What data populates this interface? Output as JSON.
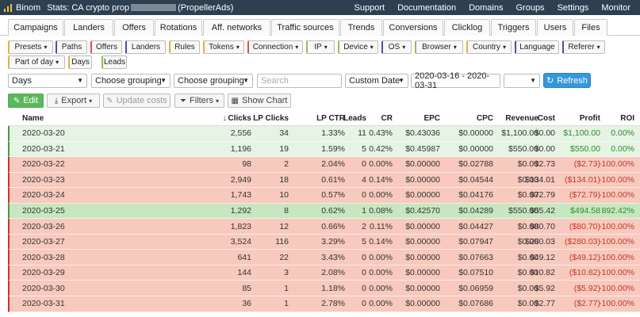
{
  "app": {
    "name": "Binom",
    "title_prefix": "Stats: CA crypto prop",
    "title_suffix": "(PropellerAds)"
  },
  "topnav": [
    "Support",
    "Documentation",
    "Domains",
    "Groups",
    "Settings",
    "Monitor"
  ],
  "tabs": [
    "Campaigns",
    "Landers",
    "Offers",
    "Rotations",
    "Aff. networks",
    "Traffic sources",
    "Trends",
    "Conversions",
    "Clicklog",
    "Triggers",
    "Users",
    "Files"
  ],
  "filters_row1": [
    {
      "label": "Presets",
      "caret": true,
      "color": "#e0b43a"
    },
    {
      "label": "Paths",
      "caret": false,
      "color": "#3f51b5"
    },
    {
      "label": "Offers",
      "caret": false,
      "color": "#d9534f"
    },
    {
      "label": "Landers",
      "caret": false,
      "color": "#3f51b5"
    },
    {
      "label": "Rules",
      "caret": false,
      "color": "#e0b43a"
    },
    {
      "label": "Tokens",
      "caret": true,
      "color": "#e0b43a"
    },
    {
      "label": "Connection",
      "caret": true,
      "color": "#d9534f"
    },
    {
      "label": "IP",
      "caret": true,
      "color": "#8bc34a"
    },
    {
      "label": "Device",
      "caret": true,
      "color": "#8bc34a"
    },
    {
      "label": "OS",
      "caret": true,
      "color": "#3f51b5"
    },
    {
      "label": "Browser",
      "caret": true,
      "color": "#8bc34a"
    },
    {
      "label": "Country",
      "caret": true,
      "color": "#e0b43a"
    },
    {
      "label": "Language",
      "caret": false,
      "color": "#3f51b5"
    },
    {
      "label": "Referer",
      "caret": true,
      "color": "#3f51b5"
    }
  ],
  "filters_row2": [
    {
      "label": "Part of day",
      "caret": true,
      "color": "#e0b43a"
    },
    {
      "label": "Days",
      "caret": false,
      "color": "#e0b43a"
    },
    {
      "label": "Leads",
      "caret": false,
      "color": "#8bc34a"
    }
  ],
  "controls": {
    "days": "Days",
    "grouping1": "Choose grouping",
    "grouping2": "Choose grouping",
    "search_placeholder": "Search",
    "date_mode": "Custom Date",
    "date_range": "2020-03-16 - 2020-03-31",
    "tz": "",
    "refresh": "Refresh"
  },
  "actions": {
    "edit": "Edit",
    "export": "Export",
    "update_costs": "Update costs",
    "filters": "Filters",
    "show_chart": "Show Chart"
  },
  "columns": [
    "Name",
    "Clicks",
    "LP Clicks",
    "LP CTR",
    "Leads",
    "CR",
    "EPC",
    "CPC",
    "Revenue",
    "Cost",
    "Profit",
    "ROI"
  ],
  "rows": [
    {
      "status": "pos",
      "name": "2020-03-20",
      "clicks": "2,556",
      "lp_clicks": "34",
      "lp_ctr": "1.33%",
      "leads": "11",
      "cr": "0.43%",
      "epc": "$0.43036",
      "cpc": "$0.00000",
      "revenue": "$1,100.00",
      "cost": "$0.00",
      "profit": "$1,100.00",
      "roi": "0.00%"
    },
    {
      "status": "pos",
      "name": "2020-03-21",
      "clicks": "1,196",
      "lp_clicks": "19",
      "lp_ctr": "1.59%",
      "leads": "5",
      "cr": "0.42%",
      "epc": "$0.45987",
      "cpc": "$0.00000",
      "revenue": "$550.00",
      "cost": "$0.00",
      "profit": "$550.00",
      "roi": "0.00%"
    },
    {
      "status": "neg",
      "name": "2020-03-22",
      "clicks": "98",
      "lp_clicks": "2",
      "lp_ctr": "2.04%",
      "leads": "0",
      "cr": "0.00%",
      "epc": "$0.00000",
      "cpc": "$0.02788",
      "revenue": "$0.00",
      "cost": "$2.73",
      "profit": "($2.73)",
      "roi": "-100.00%"
    },
    {
      "status": "neg",
      "name": "2020-03-23",
      "clicks": "2,949",
      "lp_clicks": "18",
      "lp_ctr": "0.61%",
      "leads": "4",
      "cr": "0.14%",
      "epc": "$0.00000",
      "cpc": "$0.04544",
      "revenue": "$0.00",
      "cost": "$134.01",
      "profit": "($134.01)",
      "roi": "-100.00%"
    },
    {
      "status": "neg",
      "name": "2020-03-24",
      "clicks": "1,743",
      "lp_clicks": "10",
      "lp_ctr": "0.57%",
      "leads": "0",
      "cr": "0.00%",
      "epc": "$0.00000",
      "cpc": "$0.04176",
      "revenue": "$0.00",
      "cost": "$72.79",
      "profit": "($72.79)",
      "roi": "-100.00%"
    },
    {
      "status": "best",
      "name": "2020-03-25",
      "clicks": "1,292",
      "lp_clicks": "8",
      "lp_ctr": "0.62%",
      "leads": "1",
      "cr": "0.08%",
      "epc": "$0.42570",
      "cpc": "$0.04289",
      "revenue": "$550.00",
      "cost": "$55.42",
      "profit": "$494.58",
      "roi": "892.42%"
    },
    {
      "status": "neg",
      "name": "2020-03-26",
      "clicks": "1,823",
      "lp_clicks": "12",
      "lp_ctr": "0.66%",
      "leads": "2",
      "cr": "0.11%",
      "epc": "$0.00000",
      "cpc": "$0.04427",
      "revenue": "$0.00",
      "cost": "$80.70",
      "profit": "($80.70)",
      "roi": "-100.00%"
    },
    {
      "status": "neg",
      "name": "2020-03-27",
      "clicks": "3,524",
      "lp_clicks": "116",
      "lp_ctr": "3.29%",
      "leads": "5",
      "cr": "0.14%",
      "epc": "$0.00000",
      "cpc": "$0.07947",
      "revenue": "$0.00",
      "cost": "$280.03",
      "profit": "($280.03)",
      "roi": "-100.00%"
    },
    {
      "status": "neg",
      "name": "2020-03-28",
      "clicks": "641",
      "lp_clicks": "22",
      "lp_ctr": "3.43%",
      "leads": "0",
      "cr": "0.00%",
      "epc": "$0.00000",
      "cpc": "$0.07663",
      "revenue": "$0.00",
      "cost": "$49.12",
      "profit": "($49.12)",
      "roi": "-100.00%"
    },
    {
      "status": "neg",
      "name": "2020-03-29",
      "clicks": "144",
      "lp_clicks": "3",
      "lp_ctr": "2.08%",
      "leads": "0",
      "cr": "0.00%",
      "epc": "$0.00000",
      "cpc": "$0.07510",
      "revenue": "$0.00",
      "cost": "$10.82",
      "profit": "($10.82)",
      "roi": "-100.00%"
    },
    {
      "status": "neg",
      "name": "2020-03-30",
      "clicks": "85",
      "lp_clicks": "1",
      "lp_ctr": "1.18%",
      "leads": "0",
      "cr": "0.00%",
      "epc": "$0.00000",
      "cpc": "$0.06959",
      "revenue": "$0.00",
      "cost": "$5.92",
      "profit": "($5.92)",
      "roi": "-100.00%"
    },
    {
      "status": "neg",
      "name": "2020-03-31",
      "clicks": "36",
      "lp_clicks": "1",
      "lp_ctr": "2.78%",
      "leads": "0",
      "cr": "0.00%",
      "epc": "$0.00000",
      "cpc": "$0.07686",
      "revenue": "$0.00",
      "cost": "$2.77",
      "profit": "($2.77)",
      "roi": "-100.00%"
    }
  ]
}
